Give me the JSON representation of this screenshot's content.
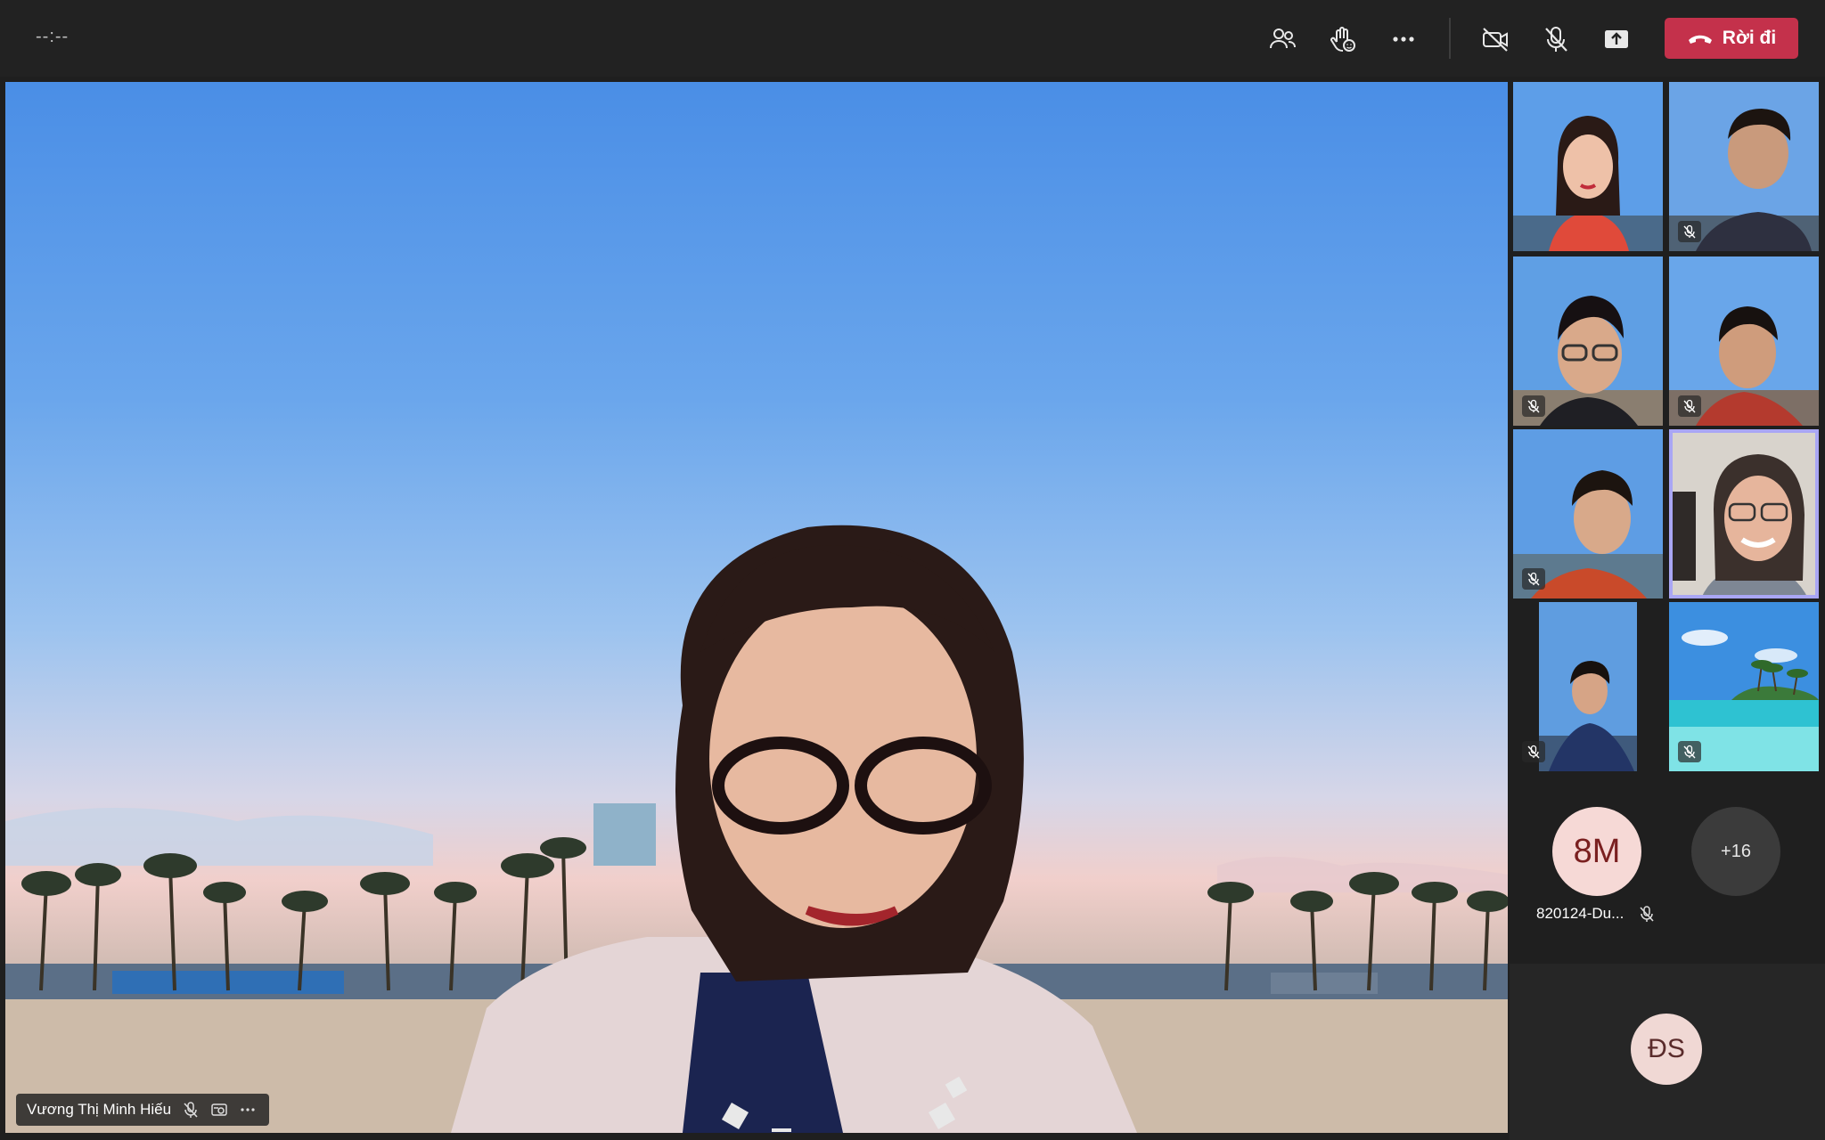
{
  "toolbar": {
    "timer": "--:--",
    "leave_label": "Rời đi",
    "icons": [
      "people-icon",
      "raise-hand-icon",
      "more-options-icon",
      "camera-off-icon",
      "mic-off-icon",
      "share-screen-icon",
      "phone-hangup-icon"
    ]
  },
  "main_stage": {
    "speaker_name": "Vương Thị Minh Hiếu",
    "background": "beach-with-palm-trees",
    "name_tag_icons": [
      "mic-off-icon",
      "background-effects-icon",
      "more-icon"
    ]
  },
  "participants": [
    {
      "tile": "participant-1",
      "muted": false
    },
    {
      "tile": "participant-2",
      "muted": true
    },
    {
      "tile": "participant-3",
      "muted": true
    },
    {
      "tile": "participant-4",
      "muted": true
    },
    {
      "tile": "participant-5",
      "muted": true
    },
    {
      "tile": "participant-6",
      "muted": false,
      "active": true
    },
    {
      "tile": "participant-7",
      "muted": true
    },
    {
      "tile": "participant-8",
      "muted": true
    }
  ],
  "roster": {
    "avatar_initials": "8M",
    "avatar_label": "820124-Du...",
    "overflow_count": "+16",
    "bottom_avatar_initials": "ĐS"
  },
  "colors": {
    "leave_button": "#c4314b",
    "active_speaker_outline": "#a9a6f4",
    "topbar": "#222222",
    "background": "#1f1f1f"
  }
}
